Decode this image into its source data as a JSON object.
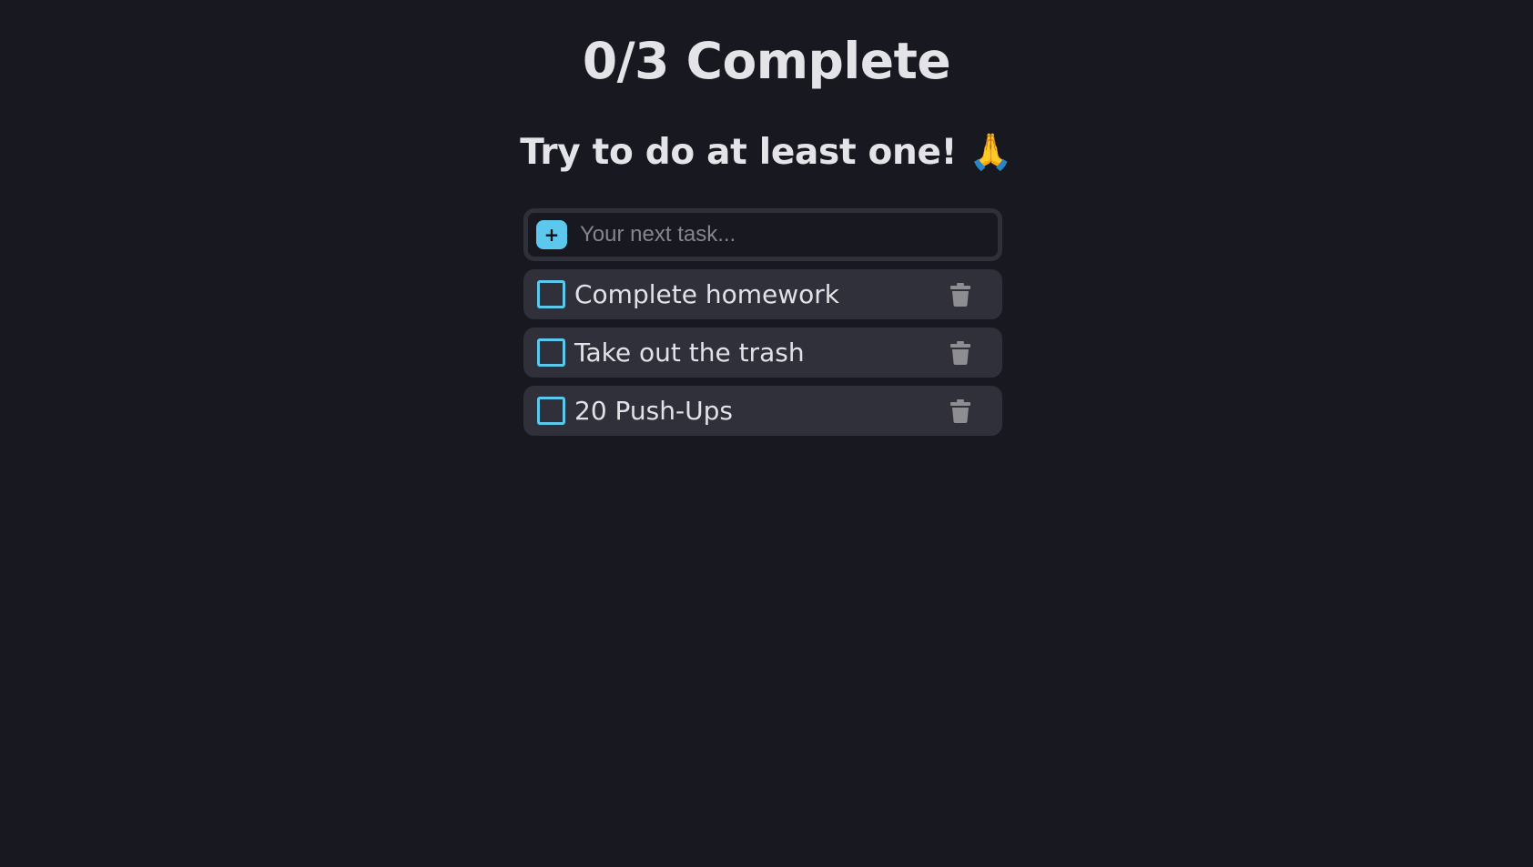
{
  "header": {
    "progress_text": "0/3 Complete",
    "motivation_text": "Try to do at least one! 🙏"
  },
  "new_task": {
    "add_icon": "plus-icon",
    "add_label": "+",
    "placeholder": "Your next task...",
    "value": ""
  },
  "tasks": [
    {
      "label": "Complete homework",
      "completed": false,
      "delete_icon": "trash-icon"
    },
    {
      "label": "Take out the trash",
      "completed": false,
      "delete_icon": "trash-icon"
    },
    {
      "label": "20 Push-Ups",
      "completed": false,
      "delete_icon": "trash-icon"
    }
  ],
  "colors": {
    "background": "#181820",
    "card": "#30303b",
    "accent": "#5cc8ee",
    "text": "#e4e4e8",
    "icon_muted": "#8d8d92"
  }
}
